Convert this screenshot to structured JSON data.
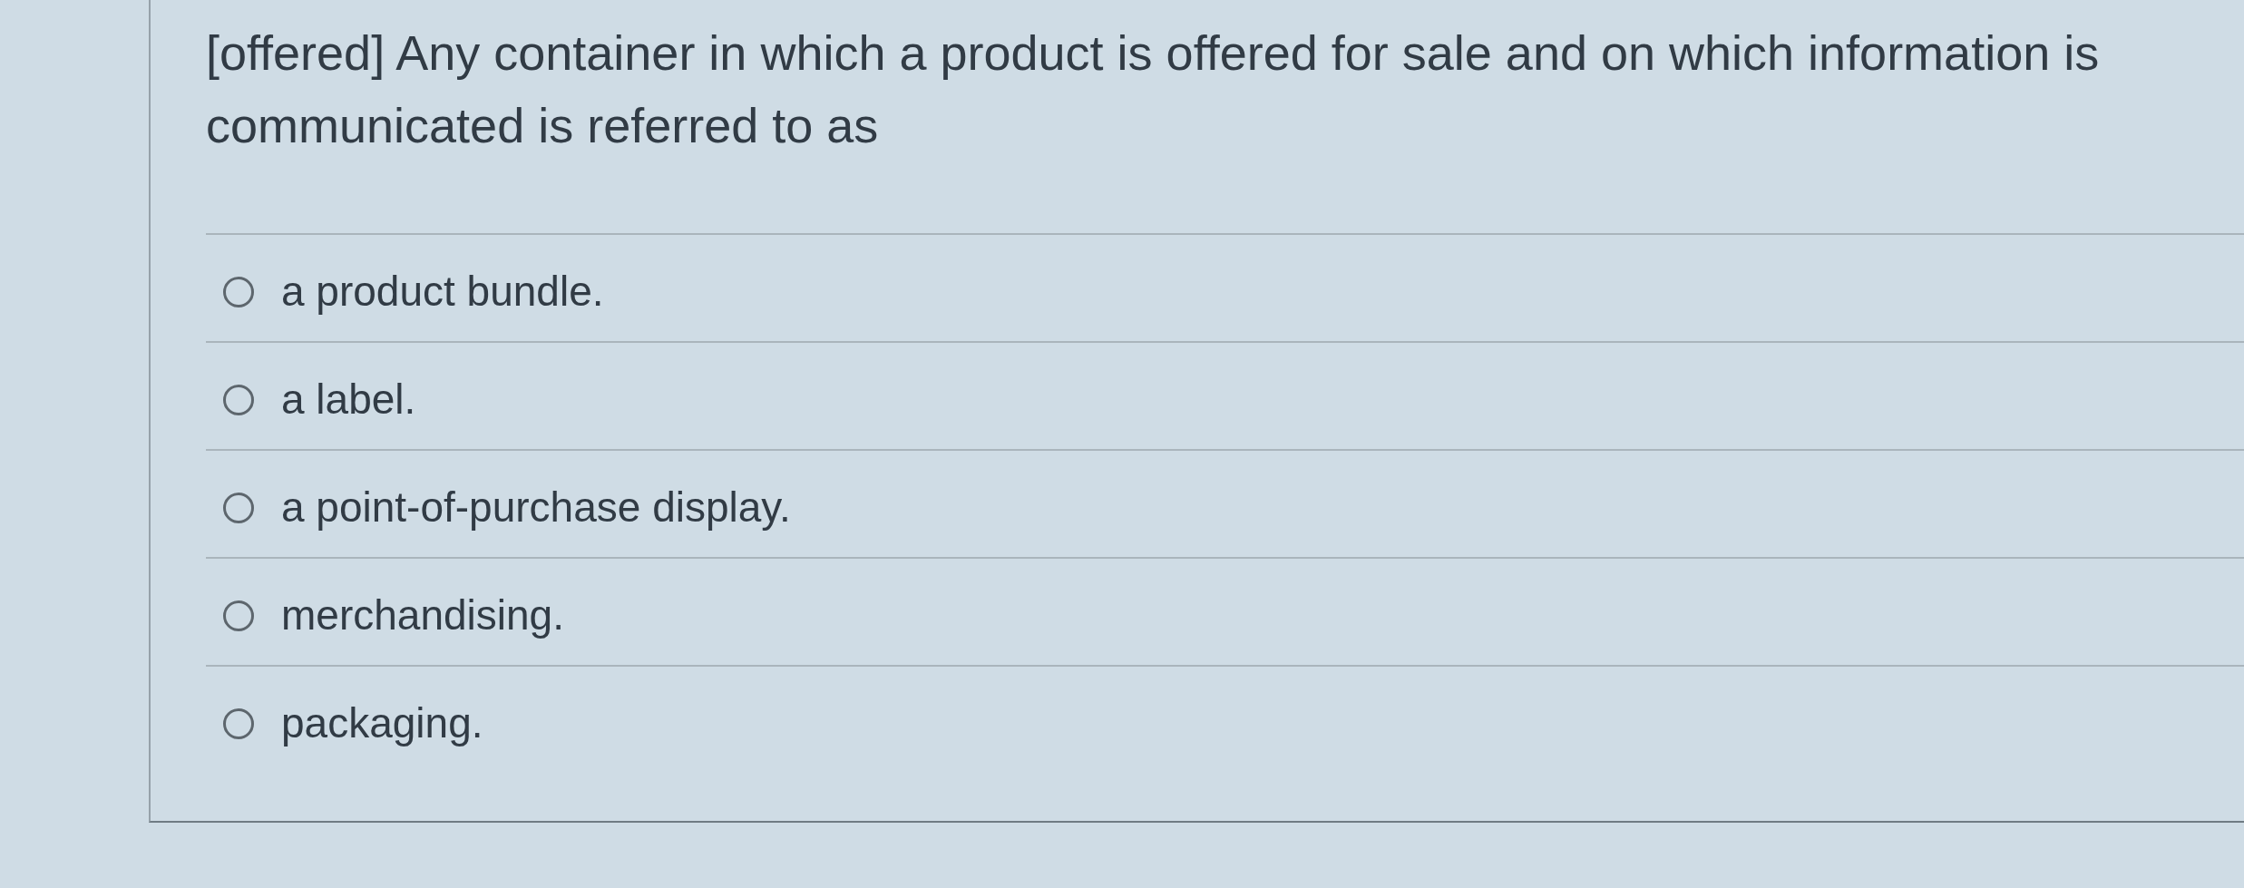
{
  "question": {
    "text": "[offered] Any container in which a product is offered for sale and on which information is communicated is referred to as"
  },
  "options": [
    {
      "label": "a product bundle.",
      "selected": false
    },
    {
      "label": "a label.",
      "selected": false
    },
    {
      "label": "a point-of-purchase display.",
      "selected": false
    },
    {
      "label": "merchandising.",
      "selected": false
    },
    {
      "label": "packaging.",
      "selected": false
    }
  ]
}
